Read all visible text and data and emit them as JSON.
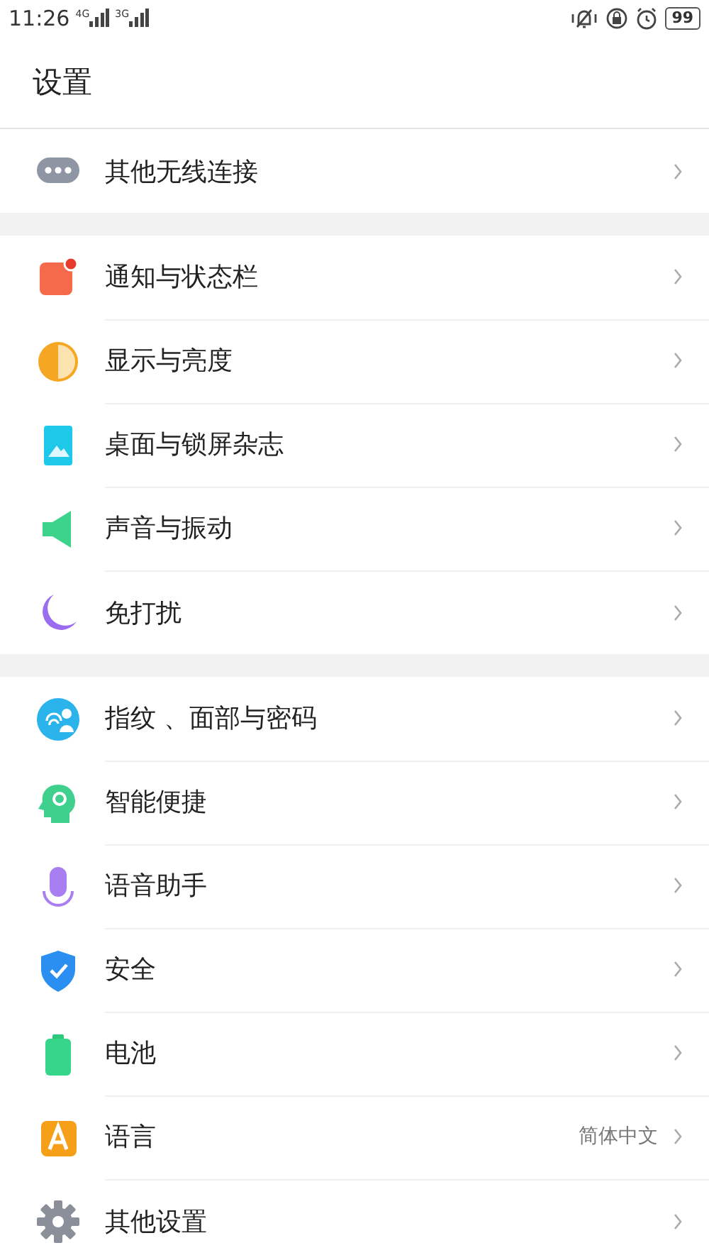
{
  "status_bar": {
    "time": "11:26",
    "sim1_network": "4G",
    "sim2_network": "3G",
    "battery": "99"
  },
  "title": "设置",
  "groups": [
    {
      "items": [
        {
          "label": "其他无线连接"
        }
      ]
    },
    {
      "items": [
        {
          "label": "通知与状态栏"
        },
        {
          "label": "显示与亮度"
        },
        {
          "label": "桌面与锁屏杂志"
        },
        {
          "label": "声音与振动"
        },
        {
          "label": "免打扰"
        }
      ]
    },
    {
      "items": [
        {
          "label": "指纹 、面部与密码"
        },
        {
          "label": "智能便捷"
        },
        {
          "label": "语音助手"
        },
        {
          "label": "安全"
        },
        {
          "label": "电池"
        },
        {
          "label": "语言",
          "value": "简体中文"
        },
        {
          "label": "其他设置"
        }
      ]
    }
  ]
}
